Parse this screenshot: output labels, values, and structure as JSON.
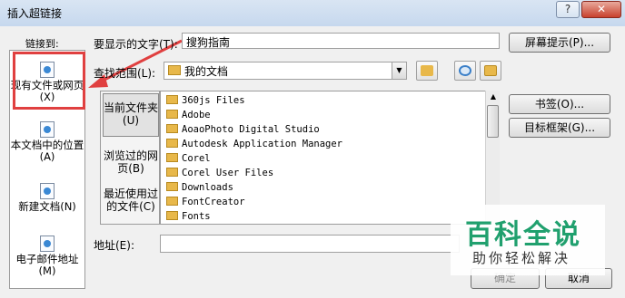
{
  "window": {
    "title": "插入超链接",
    "help_label": "?",
    "close_label": "✕"
  },
  "link_to": {
    "label": "链接到:",
    "items": [
      {
        "label": "现有文件或网页(X)",
        "icon": "globe-document-icon"
      },
      {
        "label": "本文档中的位置(A)",
        "icon": "document-position-icon"
      },
      {
        "label": "新建文档(N)",
        "icon": "new-document-icon"
      },
      {
        "label": "电子邮件地址(M)",
        "icon": "email-icon"
      }
    ]
  },
  "display_text": {
    "label": "要显示的文字(T):",
    "value": "搜狗指南"
  },
  "screentip": {
    "label": "屏幕提示(P)..."
  },
  "look_in": {
    "label": "查找范围(L):",
    "value": "我的文档",
    "dropdown": "▼"
  },
  "nav": {
    "current": "当前文件夹(U)",
    "browsed": "浏览过的网页(B)",
    "recent": "最近使用过的文件(C)"
  },
  "files": [
    "360js Files",
    "Adobe",
    "AoaoPhoto Digital Studio",
    "Autodesk Application Manager",
    "Corel",
    "Corel User Files",
    "Downloads",
    "FontCreator",
    "Fonts"
  ],
  "bookmark": {
    "label": "书签(O)..."
  },
  "target_frame": {
    "label": "目标框架(G)..."
  },
  "address": {
    "label": "地址(E):",
    "value": ""
  },
  "ok": {
    "label": "确定"
  },
  "cancel": {
    "label": "取消"
  },
  "watermark": {
    "title": "百科全说",
    "subtitle": "助你轻松解决"
  },
  "colors": {
    "highlight": "#e04040",
    "watermark": "#20a06e"
  }
}
